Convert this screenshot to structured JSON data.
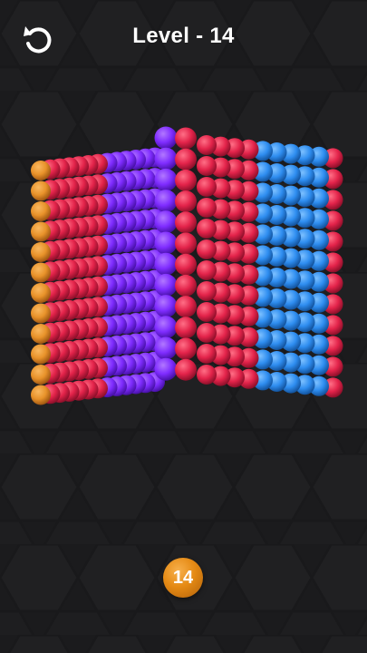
{
  "header": {
    "title": "Level - 14",
    "restart_icon": "restart-icon"
  },
  "cube": {
    "faces": [
      {
        "name": "left-face",
        "colors": [
          "#e8922a",
          "#e3234a",
          "#7f2cff"
        ]
      },
      {
        "name": "front-face",
        "colors": [
          "#7f2cff",
          "#e3234a"
        ]
      },
      {
        "name": "right-face",
        "colors": [
          "#e3234a",
          "#2e8df0"
        ]
      }
    ]
  },
  "counter": {
    "value": "14",
    "color": "#e58a14"
  },
  "colors": {
    "orange": "#e8922a",
    "red": "#e3234a",
    "purple": "#7f2cff",
    "blue": "#2e8df0",
    "background": "#1b1b1d"
  }
}
